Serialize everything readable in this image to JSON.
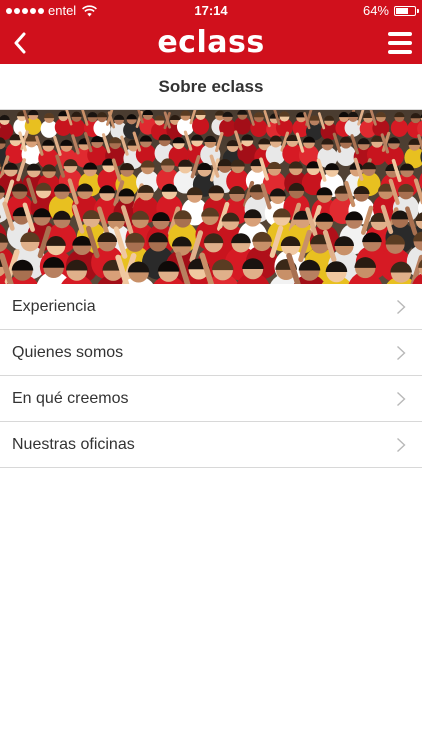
{
  "status_bar": {
    "carrier": "entel",
    "time": "17:14",
    "battery": "64%",
    "battery_level": 0.64,
    "signal_bars": 5
  },
  "nav_bar": {
    "brand": "eclass",
    "back_icon": "chevron-left-icon",
    "menu_icon": "hamburger-menu-icon"
  },
  "page": {
    "title": "Sobre eclass"
  },
  "menu": {
    "items": [
      {
        "label": "Experiencia"
      },
      {
        "label": "Quienes somos"
      },
      {
        "label": "En qué creemos"
      },
      {
        "label": "Nuestras oficinas"
      }
    ]
  },
  "colors": {
    "brand_red": "#d0101c",
    "text": "#333333",
    "divider": "#d8d8d8"
  }
}
